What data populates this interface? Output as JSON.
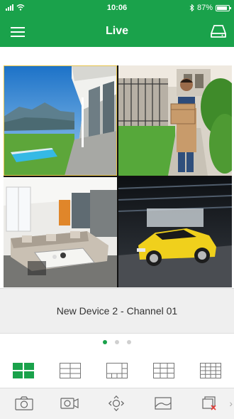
{
  "status": {
    "time": "10:06",
    "battery": "87%",
    "battery_level": 0.87,
    "icons": [
      "signal-icon",
      "wifi-icon",
      "bluetooth-icon",
      "battery-icon"
    ]
  },
  "header": {
    "title": "Live",
    "menu_icon": "hamburger-menu-icon",
    "right_icon": "storage-drive-icon"
  },
  "cameras": [
    {
      "name": "modern-house-pool-view",
      "selected": true
    },
    {
      "name": "delivery-man-at-gate-view",
      "selected": false
    },
    {
      "name": "living-room-view",
      "selected": false
    },
    {
      "name": "garage-yellow-car-view",
      "selected": false
    }
  ],
  "caption": "New Device 2 - Channel 01",
  "pager": {
    "count": 3,
    "active_index": 0
  },
  "layouts": [
    {
      "name": "layout-4-split-icon",
      "active": true
    },
    {
      "name": "layout-6-split-icon",
      "active": false
    },
    {
      "name": "layout-8-split-icon",
      "active": false
    },
    {
      "name": "layout-9-split-icon",
      "active": false
    },
    {
      "name": "layout-16-split-icon",
      "active": false
    }
  ],
  "tools": [
    "camera-snapshot-icon",
    "video-record-icon",
    "ptz-direction-icon",
    "image-quality-icon",
    "close-all-windows-icon"
  ],
  "colors": {
    "brand": "#1aa24b",
    "close_red": "#e53935",
    "selection": "#e6c34a"
  }
}
